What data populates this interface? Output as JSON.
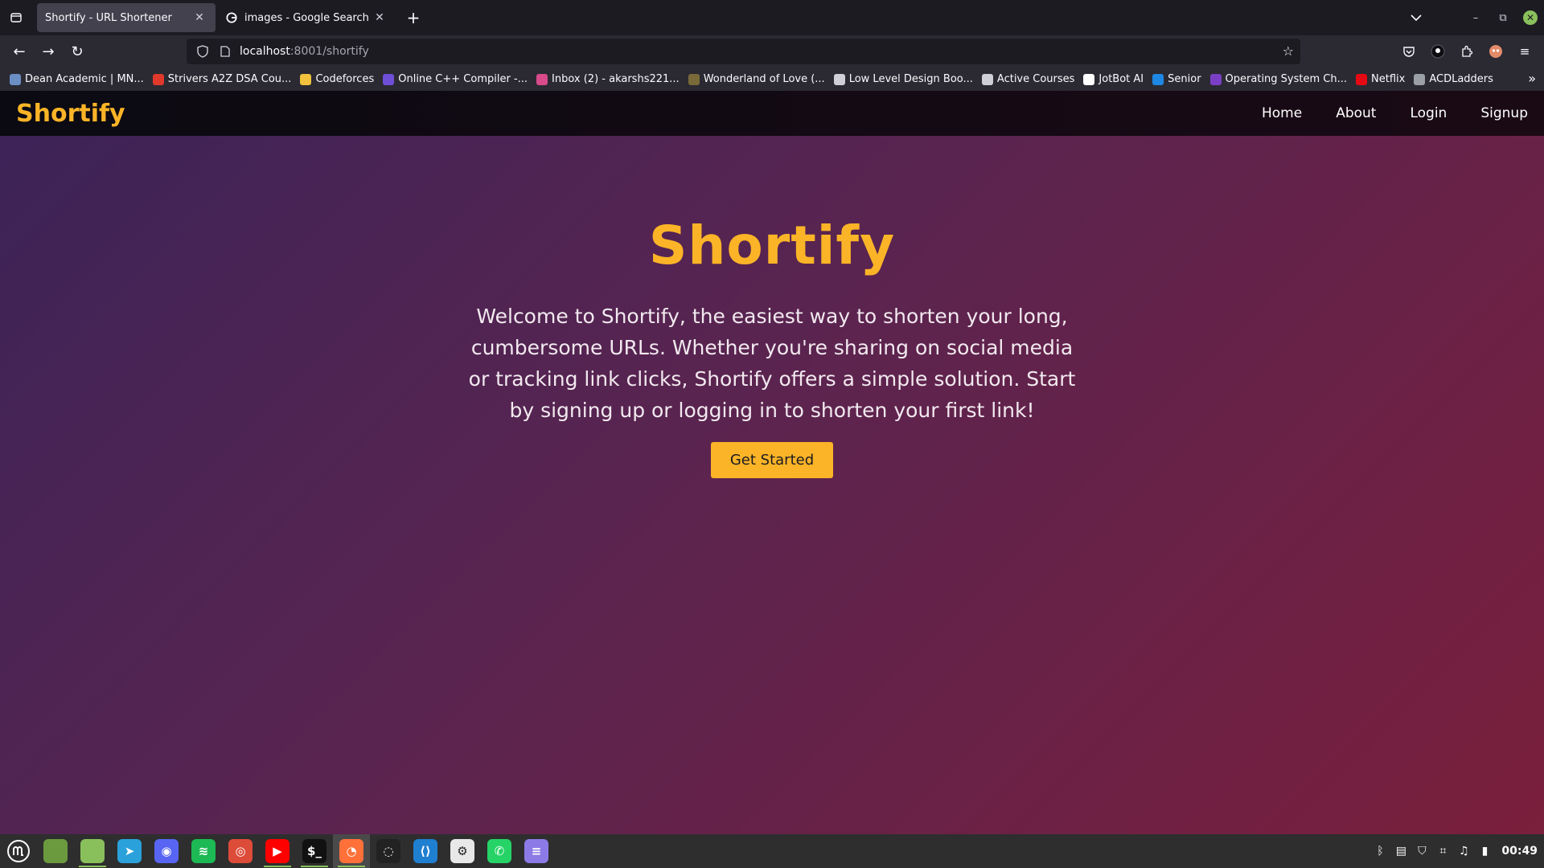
{
  "browser": {
    "tabs": [
      {
        "label": "Shortify - URL Shortener",
        "active": true
      },
      {
        "label": "images - Google Search",
        "active": false
      }
    ],
    "url_host": "localhost",
    "url_path": ":8001/shortify",
    "bookmarks": [
      {
        "label": "Dean Academic | MN...",
        "color": "#6b8fc4"
      },
      {
        "label": "Strivers A2Z DSA Cou...",
        "color": "#e0392b"
      },
      {
        "label": "Codeforces",
        "color": "#f2c13d"
      },
      {
        "label": "Online C++ Compiler -...",
        "color": "#6f4fd8"
      },
      {
        "label": "Inbox (2) - akarshs221...",
        "color": "#d94a8a"
      },
      {
        "label": "Wonderland of Love (...",
        "color": "#7a6a3a"
      },
      {
        "label": "Low Level Design Boo...",
        "color": "#cfcfd8"
      },
      {
        "label": "Active Courses",
        "color": "#cfcfd8"
      },
      {
        "label": "JotBot AI",
        "color": "#ffffff"
      },
      {
        "label": "Senior",
        "color": "#1e88e5"
      },
      {
        "label": "Operating System Ch...",
        "color": "#7b3fc6"
      },
      {
        "label": "Netflix",
        "color": "#e50914"
      },
      {
        "label": "ACDLadders",
        "color": "#9aa0a6"
      }
    ]
  },
  "site": {
    "brand": "Shortify",
    "nav": [
      "Home",
      "About",
      "Login",
      "Signup"
    ],
    "hero_title": "Shortify",
    "hero_text": "Welcome to Shortify, the easiest way to shorten your long, cumbersome URLs. Whether you're sharing on social media or tracking link clicks, Shortify offers a simple solution. Start by signing up or logging in to shorten your first link!",
    "cta": "Get Started",
    "accent_color": "#fbb427"
  },
  "taskbar": {
    "apps": [
      {
        "name": "files-green",
        "color": "#6b9a3e",
        "glyph": ""
      },
      {
        "name": "folder",
        "color": "#8ac05c",
        "glyph": ""
      },
      {
        "name": "telegram",
        "color": "#2aa1da",
        "glyph": "➤"
      },
      {
        "name": "discord",
        "color": "#5865f2",
        "glyph": "◉"
      },
      {
        "name": "spotify",
        "color": "#1db954",
        "glyph": "≋"
      },
      {
        "name": "chrome",
        "color": "#dd4b39",
        "glyph": "◎"
      },
      {
        "name": "youtube",
        "color": "#ff0000",
        "glyph": "▶"
      },
      {
        "name": "terminal",
        "color": "#111111",
        "glyph": "$_"
      },
      {
        "name": "firefox",
        "color": "#ff7139",
        "glyph": "◔"
      },
      {
        "name": "obs",
        "color": "#222222",
        "glyph": "◌"
      },
      {
        "name": "vscode",
        "color": "#1f7fd0",
        "glyph": "⟨⟩"
      },
      {
        "name": "settings",
        "color": "#e8e8e8",
        "glyph": "⚙"
      },
      {
        "name": "whatsapp",
        "color": "#25d366",
        "glyph": "✆"
      },
      {
        "name": "notes",
        "color": "#8c7ae6",
        "glyph": "≡"
      }
    ],
    "clock": "00:49"
  }
}
